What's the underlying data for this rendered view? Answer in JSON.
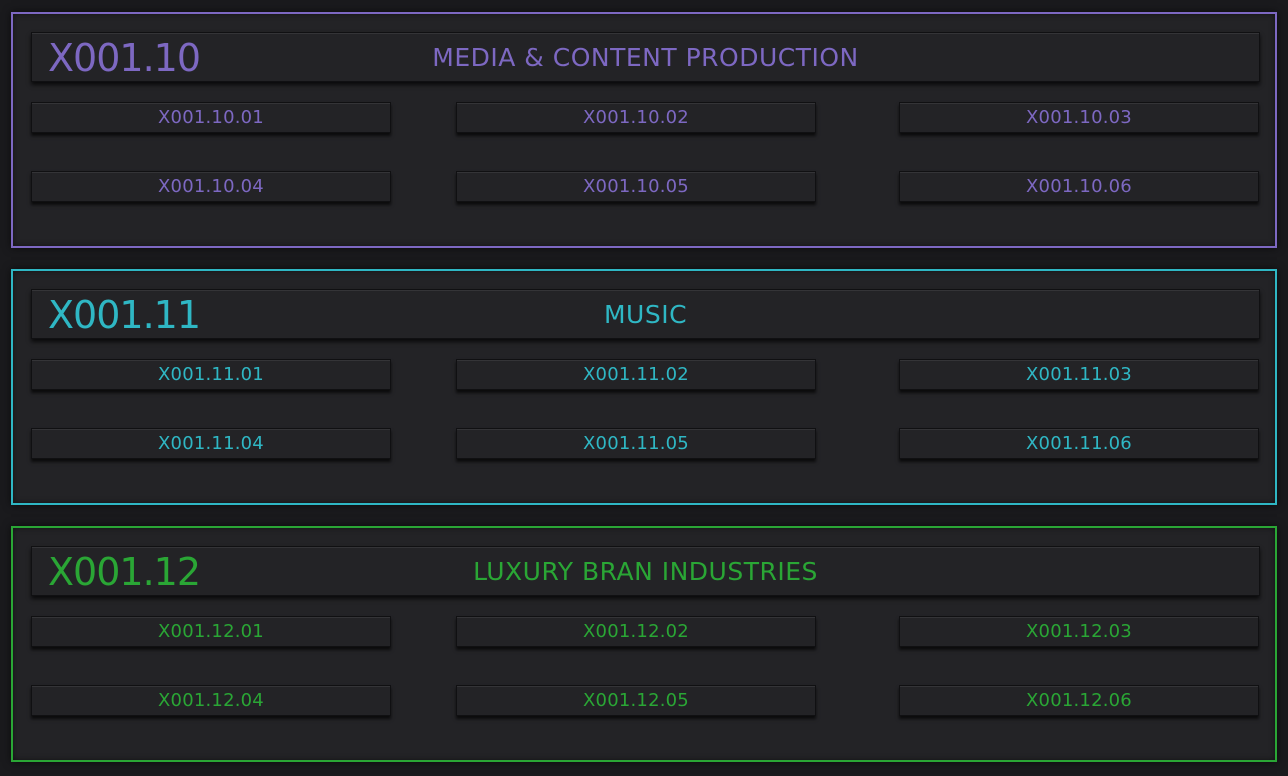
{
  "sections": [
    {
      "code": "X001.10",
      "title": "MEDIA & CONTENT PRODUCTION",
      "color": "#7d68c2",
      "items": [
        "X001.10.01",
        "X001.10.02",
        "X001.10.03",
        "X001.10.04",
        "X001.10.05",
        "X001.10.06"
      ]
    },
    {
      "code": "X001.11",
      "title": "MUSIC",
      "color": "#2fb7c4",
      "items": [
        "X001.11.01",
        "X001.11.02",
        "X001.11.03",
        "X001.11.04",
        "X001.11.05",
        "X001.11.06"
      ]
    },
    {
      "code": "X001.12",
      "title": "LUXURY BRAN INDUSTRIES",
      "color": "#2aa635",
      "items": [
        "X001.12.01",
        "X001.12.02",
        "X001.12.03",
        "X001.12.04",
        "X001.12.05",
        "X001.12.06"
      ]
    }
  ]
}
